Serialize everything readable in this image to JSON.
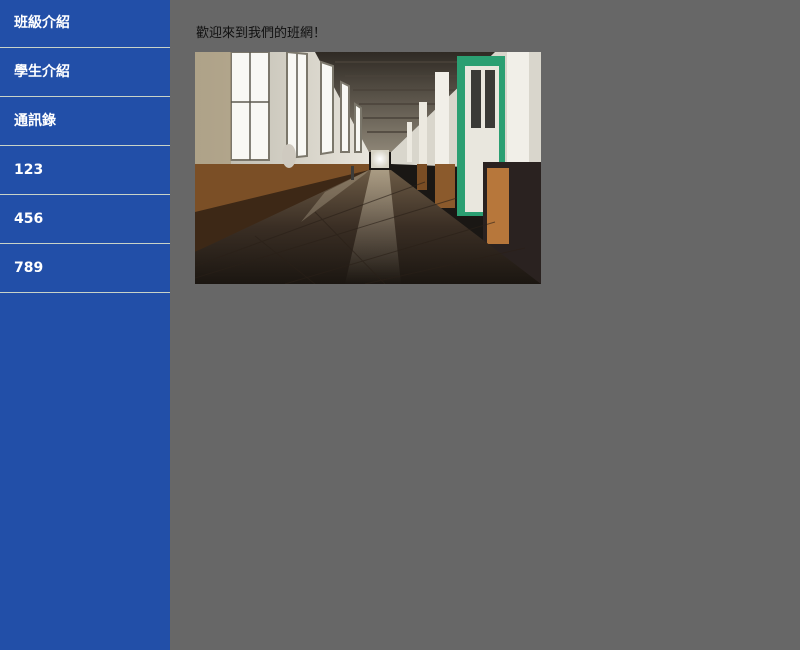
{
  "sidebar": {
    "items": [
      {
        "label": "班級介紹"
      },
      {
        "label": "學生介紹"
      },
      {
        "label": "通訊錄"
      },
      {
        "label": "123"
      },
      {
        "label": "456"
      },
      {
        "label": "789"
      }
    ]
  },
  "main": {
    "welcome_text": "歡迎來到我們的班網！"
  },
  "colors": {
    "sidebar_bg": "#224fa8",
    "content_bg": "#676767",
    "divider": "#c9d3c8"
  }
}
